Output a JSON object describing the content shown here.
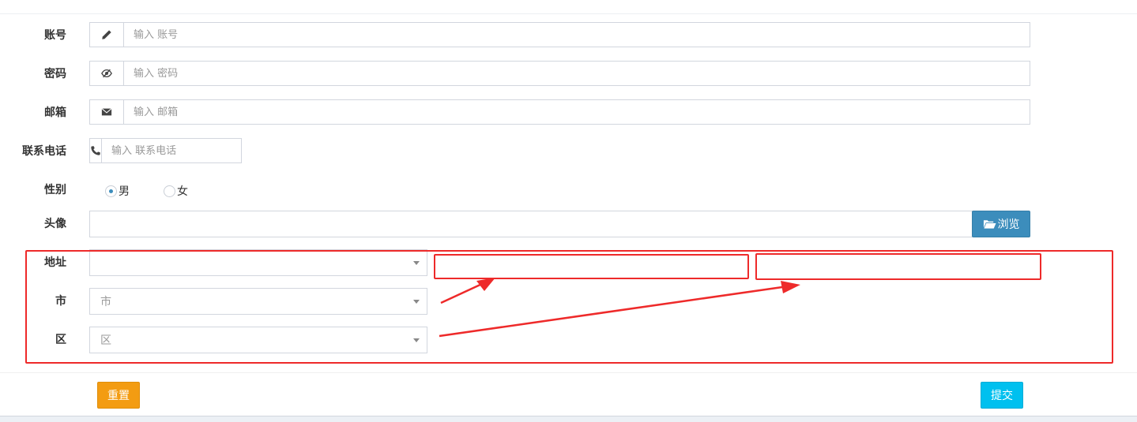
{
  "form": {
    "account": {
      "label": "账号",
      "placeholder": "输入 账号"
    },
    "password": {
      "label": "密码",
      "placeholder": "输入 密码"
    },
    "email": {
      "label": "邮箱",
      "placeholder": "输入 邮箱"
    },
    "phone": {
      "label": "联系电话",
      "placeholder": "输入 联系电话"
    },
    "gender": {
      "label": "性别",
      "options": [
        "男",
        "女"
      ],
      "selected": "男"
    },
    "avatar": {
      "label": "头像",
      "value": "",
      "browse_label": "浏览"
    },
    "address": {
      "province_label": "地址",
      "province_value": "",
      "city_label": "市",
      "city_value": "市",
      "district_label": "区",
      "district_value": "区"
    }
  },
  "buttons": {
    "reset": "重置",
    "submit": "提交"
  },
  "icons": {
    "account": "pencil-icon",
    "password": "eye-slash-icon",
    "email": "envelope-icon",
    "phone": "phone-icon",
    "browse": "folder-open-icon",
    "select": "caret-down-icon"
  },
  "colors": {
    "primary": "#3c8dbc",
    "warning": "#f39c12",
    "info": "#00c0ef",
    "annotation": "#ee2a2a"
  }
}
